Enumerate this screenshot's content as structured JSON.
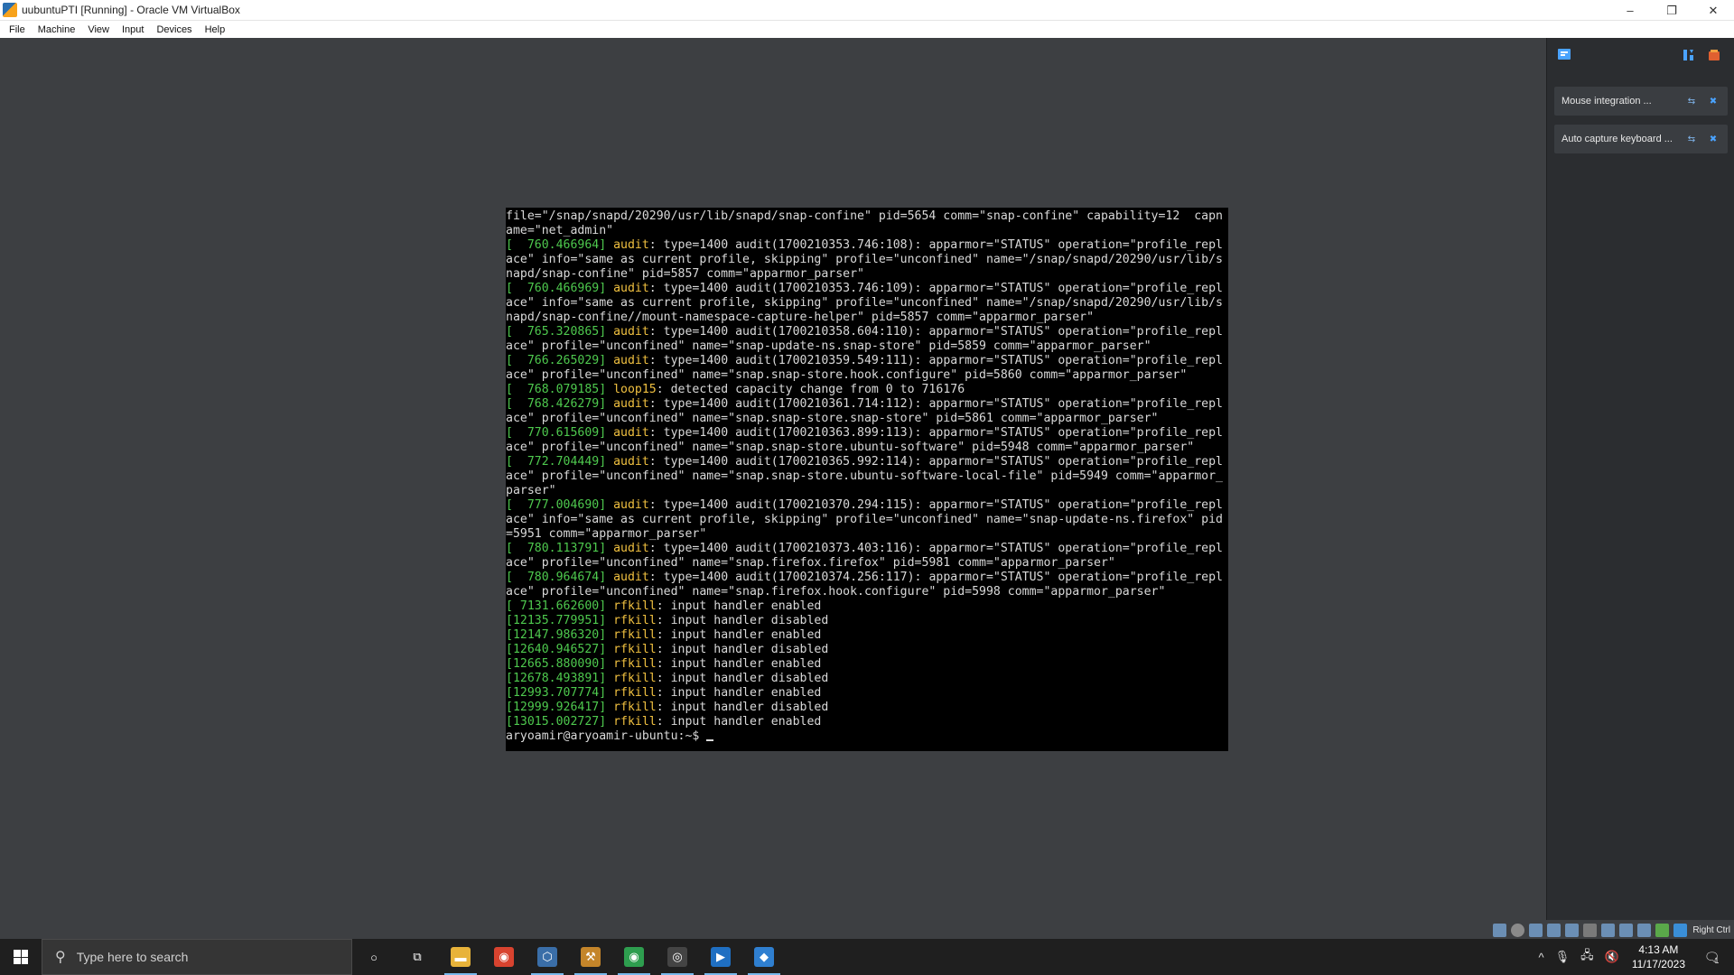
{
  "window": {
    "title": "uubuntuPTI [Running] - Oracle VM VirtualBox",
    "minimize": "–",
    "restore": "❐",
    "close": "✕"
  },
  "menu": [
    "File",
    "Machine",
    "View",
    "Input",
    "Devices",
    "Help"
  ],
  "terminal": {
    "lines": [
      [
        {
          "t": "file=\"/snap/snapd/20290/usr/lib/snapd/snap-confine\" pid=5654 comm=\"snap-confine\" capability=12  capn",
          "c": ""
        }
      ],
      [
        {
          "t": "ame=\"net_admin\"",
          "c": ""
        }
      ],
      [
        {
          "t": "[  760.466964] ",
          "c": "ts"
        },
        {
          "t": "audit",
          "c": "kw"
        },
        {
          "t": ": type=1400 audit(1700210353.746:108): apparmor=\"STATUS\" operation=\"profile_repl",
          "c": ""
        }
      ],
      [
        {
          "t": "ace\" info=\"same as current profile, skipping\" profile=\"unconfined\" name=\"/snap/snapd/20290/usr/lib/s",
          "c": ""
        }
      ],
      [
        {
          "t": "napd/snap-confine\" pid=5857 comm=\"apparmor_parser\"",
          "c": ""
        }
      ],
      [
        {
          "t": "[  760.466969] ",
          "c": "ts"
        },
        {
          "t": "audit",
          "c": "kw"
        },
        {
          "t": ": type=1400 audit(1700210353.746:109): apparmor=\"STATUS\" operation=\"profile_repl",
          "c": ""
        }
      ],
      [
        {
          "t": "ace\" info=\"same as current profile, skipping\" profile=\"unconfined\" name=\"/snap/snapd/20290/usr/lib/s",
          "c": ""
        }
      ],
      [
        {
          "t": "napd/snap-confine//mount-namespace-capture-helper\" pid=5857 comm=\"apparmor_parser\"",
          "c": ""
        }
      ],
      [
        {
          "t": "[  765.320865] ",
          "c": "ts"
        },
        {
          "t": "audit",
          "c": "kw"
        },
        {
          "t": ": type=1400 audit(1700210358.604:110): apparmor=\"STATUS\" operation=\"profile_repl",
          "c": ""
        }
      ],
      [
        {
          "t": "ace\" profile=\"unconfined\" name=\"snap-update-ns.snap-store\" pid=5859 comm=\"apparmor_parser\"",
          "c": ""
        }
      ],
      [
        {
          "t": "[  766.265029] ",
          "c": "ts"
        },
        {
          "t": "audit",
          "c": "kw"
        },
        {
          "t": ": type=1400 audit(1700210359.549:111): apparmor=\"STATUS\" operation=\"profile_repl",
          "c": ""
        }
      ],
      [
        {
          "t": "ace\" profile=\"unconfined\" name=\"snap.snap-store.hook.configure\" pid=5860 comm=\"apparmor_parser\"",
          "c": ""
        }
      ],
      [
        {
          "t": "[  768.079185] ",
          "c": "ts"
        },
        {
          "t": "loop15",
          "c": "kw"
        },
        {
          "t": ": detected capacity change from 0 to 716176",
          "c": ""
        }
      ],
      [
        {
          "t": "[  768.426279] ",
          "c": "ts"
        },
        {
          "t": "audit",
          "c": "kw"
        },
        {
          "t": ": type=1400 audit(1700210361.714:112): apparmor=\"STATUS\" operation=\"profile_repl",
          "c": ""
        }
      ],
      [
        {
          "t": "ace\" profile=\"unconfined\" name=\"snap.snap-store.snap-store\" pid=5861 comm=\"apparmor_parser\"",
          "c": ""
        }
      ],
      [
        {
          "t": "[  770.615609] ",
          "c": "ts"
        },
        {
          "t": "audit",
          "c": "kw"
        },
        {
          "t": ": type=1400 audit(1700210363.899:113): apparmor=\"STATUS\" operation=\"profile_repl",
          "c": ""
        }
      ],
      [
        {
          "t": "ace\" profile=\"unconfined\" name=\"snap.snap-store.ubuntu-software\" pid=5948 comm=\"apparmor_parser\"",
          "c": ""
        }
      ],
      [
        {
          "t": "[  772.704449] ",
          "c": "ts"
        },
        {
          "t": "audit",
          "c": "kw"
        },
        {
          "t": ": type=1400 audit(1700210365.992:114): apparmor=\"STATUS\" operation=\"profile_repl",
          "c": ""
        }
      ],
      [
        {
          "t": "ace\" profile=\"unconfined\" name=\"snap.snap-store.ubuntu-software-local-file\" pid=5949 comm=\"apparmor_",
          "c": ""
        }
      ],
      [
        {
          "t": "parser\"",
          "c": ""
        }
      ],
      [
        {
          "t": "[  777.004690] ",
          "c": "ts"
        },
        {
          "t": "audit",
          "c": "kw"
        },
        {
          "t": ": type=1400 audit(1700210370.294:115): apparmor=\"STATUS\" operation=\"profile_repl",
          "c": ""
        }
      ],
      [
        {
          "t": "ace\" info=\"same as current profile, skipping\" profile=\"unconfined\" name=\"snap-update-ns.firefox\" pid",
          "c": ""
        }
      ],
      [
        {
          "t": "=5951 comm=\"apparmor_parser\"",
          "c": ""
        }
      ],
      [
        {
          "t": "[  780.113791] ",
          "c": "ts"
        },
        {
          "t": "audit",
          "c": "kw"
        },
        {
          "t": ": type=1400 audit(1700210373.403:116): apparmor=\"STATUS\" operation=\"profile_repl",
          "c": ""
        }
      ],
      [
        {
          "t": "ace\" profile=\"unconfined\" name=\"snap.firefox.firefox\" pid=5981 comm=\"apparmor_parser\"",
          "c": ""
        }
      ],
      [
        {
          "t": "[  780.964674] ",
          "c": "ts"
        },
        {
          "t": "audit",
          "c": "kw"
        },
        {
          "t": ": type=1400 audit(1700210374.256:117): apparmor=\"STATUS\" operation=\"profile_repl",
          "c": ""
        }
      ],
      [
        {
          "t": "ace\" profile=\"unconfined\" name=\"snap.firefox.hook.configure\" pid=5998 comm=\"apparmor_parser\"",
          "c": ""
        }
      ],
      [
        {
          "t": "[ 7131.662600] ",
          "c": "ts"
        },
        {
          "t": "rfkill",
          "c": "kw"
        },
        {
          "t": ": input handler enabled",
          "c": ""
        }
      ],
      [
        {
          "t": "[12135.779951] ",
          "c": "ts"
        },
        {
          "t": "rfkill",
          "c": "kw"
        },
        {
          "t": ": input handler disabled",
          "c": ""
        }
      ],
      [
        {
          "t": "[12147.986320] ",
          "c": "ts"
        },
        {
          "t": "rfkill",
          "c": "kw"
        },
        {
          "t": ": input handler enabled",
          "c": ""
        }
      ],
      [
        {
          "t": "[12640.946527] ",
          "c": "ts"
        },
        {
          "t": "rfkill",
          "c": "kw"
        },
        {
          "t": ": input handler disabled",
          "c": ""
        }
      ],
      [
        {
          "t": "[12665.880090] ",
          "c": "ts"
        },
        {
          "t": "rfkill",
          "c": "kw"
        },
        {
          "t": ": input handler enabled",
          "c": ""
        }
      ],
      [
        {
          "t": "[12678.493891] ",
          "c": "ts"
        },
        {
          "t": "rfkill",
          "c": "kw"
        },
        {
          "t": ": input handler disabled",
          "c": ""
        }
      ],
      [
        {
          "t": "[12993.707774] ",
          "c": "ts"
        },
        {
          "t": "rfkill",
          "c": "kw"
        },
        {
          "t": ": input handler enabled",
          "c": ""
        }
      ],
      [
        {
          "t": "[12999.926417] ",
          "c": "ts"
        },
        {
          "t": "rfkill",
          "c": "kw"
        },
        {
          "t": ": input handler disabled",
          "c": ""
        }
      ],
      [
        {
          "t": "[13015.002727] ",
          "c": "ts"
        },
        {
          "t": "rfkill",
          "c": "kw"
        },
        {
          "t": ": input handler enabled",
          "c": ""
        }
      ]
    ],
    "prompt": "aryoamir@aryoamir-ubuntu:~$ "
  },
  "notifications": [
    {
      "text": "Mouse integration ...",
      "toggle": "⇆",
      "close": "✖"
    },
    {
      "text": "Auto capture keyboard ...",
      "toggle": "⇆",
      "close": "✖"
    }
  ],
  "status_bar": {
    "host_key": "Right Ctrl"
  },
  "taskbar": {
    "search_placeholder": "Type here to search",
    "search_icon": "search-icon",
    "apps": [
      {
        "name": "cortana",
        "glyph": "○",
        "color": "transparent",
        "active": false
      },
      {
        "name": "task-view",
        "glyph": "⧉",
        "color": "transparent",
        "active": false
      },
      {
        "name": "file-explorer",
        "glyph": "▬",
        "color": "#e8b33a",
        "active": true
      },
      {
        "name": "chrome",
        "glyph": "◉",
        "color": "#d8432f",
        "active": false
      },
      {
        "name": "virtualbox",
        "glyph": "⬡",
        "color": "#3a6ea8",
        "active": true
      },
      {
        "name": "vm-app",
        "glyph": "⚒",
        "color": "#c4852a",
        "active": true
      },
      {
        "name": "chrome-profile",
        "glyph": "◉",
        "color": "#2e9e4f",
        "active": true
      },
      {
        "name": "obs",
        "glyph": "◎",
        "color": "#444444",
        "active": true
      },
      {
        "name": "media-app",
        "glyph": "▶",
        "color": "#1f6fc2",
        "active": true
      },
      {
        "name": "vm-window",
        "glyph": "◆",
        "color": "#2f7fd0",
        "active": true
      }
    ],
    "tray_chevron": "^",
    "time": "4:13 AM",
    "date": "11/17/2023",
    "notification_count": "1"
  },
  "colors": {
    "timestamp": "#4ec94e",
    "keyword": "#f0c040",
    "terminal_bg": "#000000",
    "vm_bg": "#3d3f42"
  }
}
